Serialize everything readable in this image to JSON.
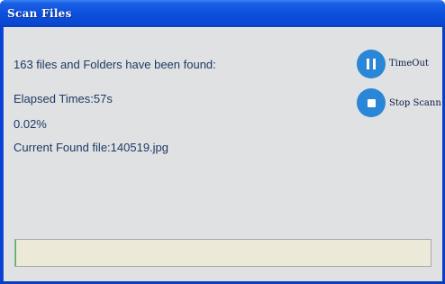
{
  "window": {
    "title": "Scan Files"
  },
  "status": {
    "found_text": "163 files and Folders have been found:",
    "elapsed_text": "Elapsed Times:57s",
    "percent_text": "0.02%",
    "current_file_text": "Current Found file:140519.jpg"
  },
  "buttons": {
    "timeout_label": "TimeOut",
    "stop_label": "Stop Scann"
  },
  "progress": {
    "percent": 0.02
  },
  "icons": {
    "pause": "pause-icon",
    "stop": "stop-icon"
  },
  "colors": {
    "title_bar": "#0c4fdc",
    "client_bg": "#dfe1e3",
    "text": "#1f3a64",
    "button_circle": "#2a86d6",
    "progress_track": "#ece9d8"
  }
}
